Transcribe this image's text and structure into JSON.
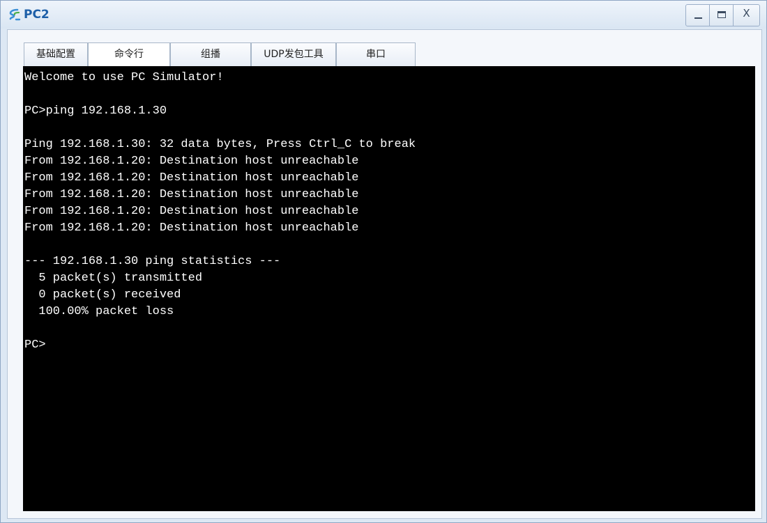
{
  "window": {
    "title": "PC2",
    "controls": {
      "minimize_icon": "minimize-icon",
      "maximize_icon": "maximize-icon",
      "close_label": "X"
    }
  },
  "tabs": [
    {
      "label": "基础配置",
      "active": false
    },
    {
      "label": "命令行",
      "active": true
    },
    {
      "label": "组播",
      "active": false
    },
    {
      "label": "UDP发包工具",
      "active": false
    },
    {
      "label": "串口",
      "active": false
    }
  ],
  "terminal": {
    "lines": [
      "Welcome to use PC Simulator!",
      "",
      "PC>ping 192.168.1.30",
      "",
      "Ping 192.168.1.30: 32 data bytes, Press Ctrl_C to break",
      "From 192.168.1.20: Destination host unreachable",
      "From 192.168.1.20: Destination host unreachable",
      "From 192.168.1.20: Destination host unreachable",
      "From 192.168.1.20: Destination host unreachable",
      "From 192.168.1.20: Destination host unreachable",
      "",
      "--- 192.168.1.30 ping statistics ---",
      "  5 packet(s) transmitted",
      "  0 packet(s) received",
      "  100.00% packet loss",
      "",
      "PC>"
    ]
  },
  "colors": {
    "title": "#1d5fa8",
    "terminal_bg": "#000000",
    "terminal_fg": "#ffffff"
  }
}
